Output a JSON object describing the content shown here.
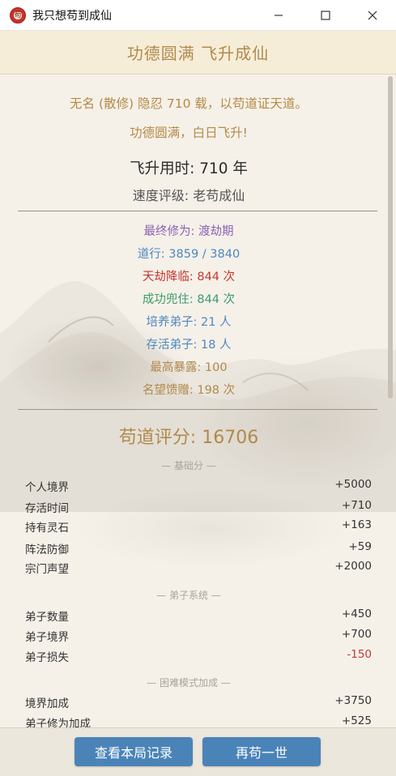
{
  "window": {
    "title": "我只想苟到成仙",
    "icon_char": "苟"
  },
  "header": {
    "title": "功德圆满 飞升成仙"
  },
  "summary": {
    "intro_line": "无名 (散修) 隐忍 710 载，以苟道证天道。",
    "result_line": "功德圆满，白日飞升!",
    "ascend_time": "飞升用时: 710 年",
    "speed_rating": "速度评级: 老苟成仙"
  },
  "stats": [
    {
      "text": "最终修为: 渡劫期",
      "color": "#8b62b3"
    },
    {
      "text": "道行: 3859 / 3840",
      "color": "#4f86bf"
    },
    {
      "text": "天劫降临: 844 次",
      "color": "#c8372d"
    },
    {
      "text": "成功兜住: 844 次",
      "color": "#3f9a6a"
    },
    {
      "text": "培养弟子: 21 人",
      "color": "#4f86bf"
    },
    {
      "text": "存活弟子: 18 人",
      "color": "#4f86bf"
    },
    {
      "text": "最高暴露: 100",
      "color": "#b08a4c"
    },
    {
      "text": "名望馈赠: 198 次",
      "color": "#b08a4c"
    }
  ],
  "score": {
    "text": "苟道评分: 16706"
  },
  "sections": {
    "base": "— 基础分 —",
    "disciples": "— 弟子系统 —",
    "hard_mode": "— 困难模式加成 —"
  },
  "base_rows": [
    {
      "label": "个人境界",
      "value": "+5000"
    },
    {
      "label": "存活时间",
      "value": "+710"
    },
    {
      "label": "持有灵石",
      "value": "+163"
    },
    {
      "label": "阵法防御",
      "value": "+59"
    },
    {
      "label": "宗门声望",
      "value": "+2000"
    }
  ],
  "disciple_rows": [
    {
      "label": "弟子数量",
      "value": "+450"
    },
    {
      "label": "弟子境界",
      "value": "+700"
    },
    {
      "label": "弟子损失",
      "value": "-150"
    }
  ],
  "hard_rows": [
    {
      "label": "境界加成",
      "value": "+3750"
    },
    {
      "label": "弟子修为加成",
      "value": "+525"
    }
  ],
  "buttons": {
    "view_record": "查看本局记录",
    "replay": "再苟一世"
  },
  "colors": {
    "accent_gold": "#b08a4c",
    "button_blue": "#4a83b8",
    "negative_red": "#c23b32"
  }
}
